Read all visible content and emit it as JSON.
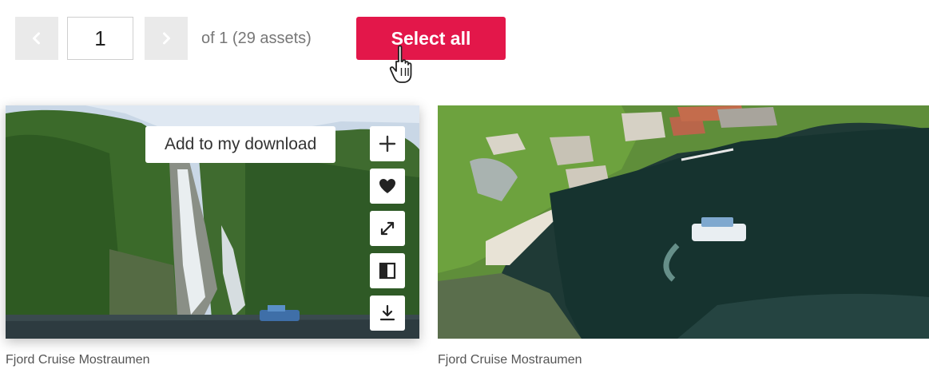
{
  "pagination": {
    "current_page": "1",
    "summary": "of 1 (29 assets)"
  },
  "toolbar": {
    "select_all_label": "Select all"
  },
  "colors": {
    "accent": "#e3174a",
    "pager_bg": "#eaeaea"
  },
  "assets": [
    {
      "caption": "Fjord Cruise Mostraumen",
      "tooltip": "Add to my download",
      "actions": [
        "plus-icon",
        "heart-icon",
        "expand-icon",
        "compare-icon",
        "download-icon"
      ]
    },
    {
      "caption": "Fjord Cruise Mostraumen"
    }
  ]
}
